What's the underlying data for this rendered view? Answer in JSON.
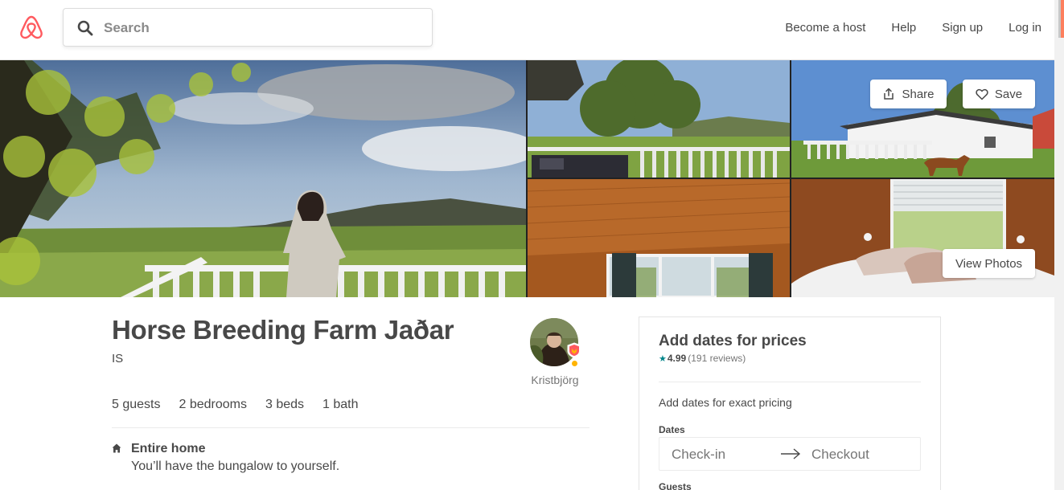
{
  "header": {
    "logo": "airbnb-logo",
    "search_placeholder": "Search",
    "nav": [
      "Become a host",
      "Help",
      "Sign up",
      "Log in"
    ]
  },
  "photos": {
    "share_label": "Share",
    "save_label": "Save",
    "view_label": "View Photos"
  },
  "listing": {
    "title": "Horse Breeding Farm Jaðar",
    "location": "IS",
    "specs": [
      "5 guests",
      "2 bedrooms",
      "3 beds",
      "1 bath"
    ],
    "home_type": "Entire home",
    "home_desc": "You’ll have the bungalow to yourself."
  },
  "host": {
    "name": "Kristbjörg",
    "superhost": true
  },
  "booking": {
    "title": "Add dates for prices",
    "star": "★",
    "score": "4.99",
    "reviews": "(191 reviews)",
    "exact_pricing": "Add dates for exact pricing",
    "dates_label": "Dates",
    "checkin": "Check-in",
    "checkout": "Checkout",
    "guests_label": "Guests"
  },
  "colors": {
    "brand": "#FF5A5F",
    "accent_teal": "#008489",
    "text": "#484848"
  }
}
